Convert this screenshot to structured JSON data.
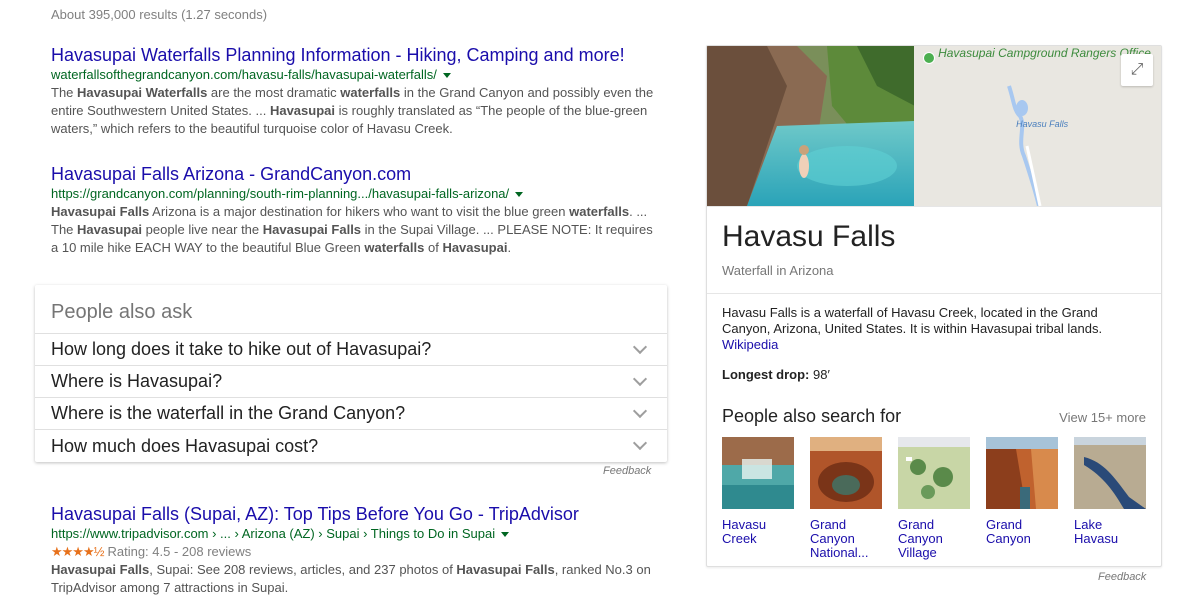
{
  "stats": "About 395,000 results (1.27 seconds)",
  "results": [
    {
      "title": "Havasupai Waterfalls Planning Information - Hiking, Camping and more!",
      "url": "waterfallsofthegrandcanyon.com/havasu-falls/havasupai-waterfalls/",
      "snippet": [
        [
          "The ",
          false
        ],
        [
          "Havasupai Waterfalls",
          true
        ],
        [
          " are the most dramatic ",
          false
        ],
        [
          "waterfalls",
          true
        ],
        [
          " in the Grand Canyon and possibly even the entire Southwestern United States. ... ",
          false
        ],
        [
          "Havasupai",
          true
        ],
        [
          " is roughly translated as “The people of the blue-green waters,” which refers to the beautiful turquoise color of Havasu Creek.",
          false
        ]
      ]
    },
    {
      "title": "Havasupai Falls Arizona - GrandCanyon.com",
      "url": "https://grandcanyon.com/planning/south-rim-planning.../havasupai-falls-arizona/",
      "snippet": [
        [
          "Havasupai Falls",
          true
        ],
        [
          " Arizona is a major destination for hikers who want to visit the blue green ",
          false
        ],
        [
          "waterfalls",
          true
        ],
        [
          ". ... The ",
          false
        ],
        [
          "Havasupai",
          true
        ],
        [
          " people live near the ",
          false
        ],
        [
          "Havasupai Falls",
          true
        ],
        [
          " in the Supai Village. ... PLEASE NOTE: It requires a 10 mile hike EACH WAY to the beautiful Blue Green ",
          false
        ],
        [
          "waterfalls",
          true
        ],
        [
          " of ",
          false
        ],
        [
          "Havasupai",
          true
        ],
        [
          ".",
          false
        ]
      ]
    },
    {
      "title": "Havasupai Falls (Supai, AZ): Top Tips Before You Go - TripAdvisor",
      "url": "https://www.tripadvisor.com › ... › Arizona (AZ) › Supai › Things to Do in Supai",
      "stars": "★★★★½",
      "rating": "Rating: 4.5 - 208 reviews",
      "rating_value": 4.5,
      "snippet": [
        [
          "Havasupai Falls",
          true
        ],
        [
          ", Supai: See 208 reviews, articles, and 237 photos of ",
          false
        ],
        [
          "Havasupai Falls",
          true
        ],
        [
          ", ranked No.3 on TripAdvisor among 7 attractions in Supai.",
          false
        ]
      ]
    }
  ],
  "paa": {
    "heading": "People also ask",
    "questions": [
      "How long does it take to hike out of Havasupai?",
      "Where is Havasupai?",
      "Where is the waterfall in the Grand Canyon?",
      "How much does Havasupai cost?"
    ],
    "feedback": "Feedback"
  },
  "kp": {
    "map_label": "Havasupai Campground Rangers Office",
    "map_water_label": "Havasu Falls",
    "title": "Havasu Falls",
    "subtitle": "Waterfall in Arizona",
    "description": "Havasu Falls is a waterfall of Havasu Creek, located in the Grand Canyon, Arizona, United States. It is within Havasupai tribal lands.",
    "source_link": "Wikipedia",
    "fact_label": "Longest drop:",
    "fact_value": " 98′",
    "pas_title": "People also search for",
    "pas_more": "View 15+ more",
    "pas_items": [
      {
        "label": "Havasu Creek"
      },
      {
        "label": "Grand Canyon National..."
      },
      {
        "label": "Grand Canyon Village"
      },
      {
        "label": "Grand Canyon"
      },
      {
        "label": "Lake Havasu"
      }
    ],
    "feedback": "Feedback"
  },
  "colors": {
    "link": "#1a0dab",
    "url": "#006621",
    "snippet": "#545454",
    "stars": "#e7711b"
  }
}
